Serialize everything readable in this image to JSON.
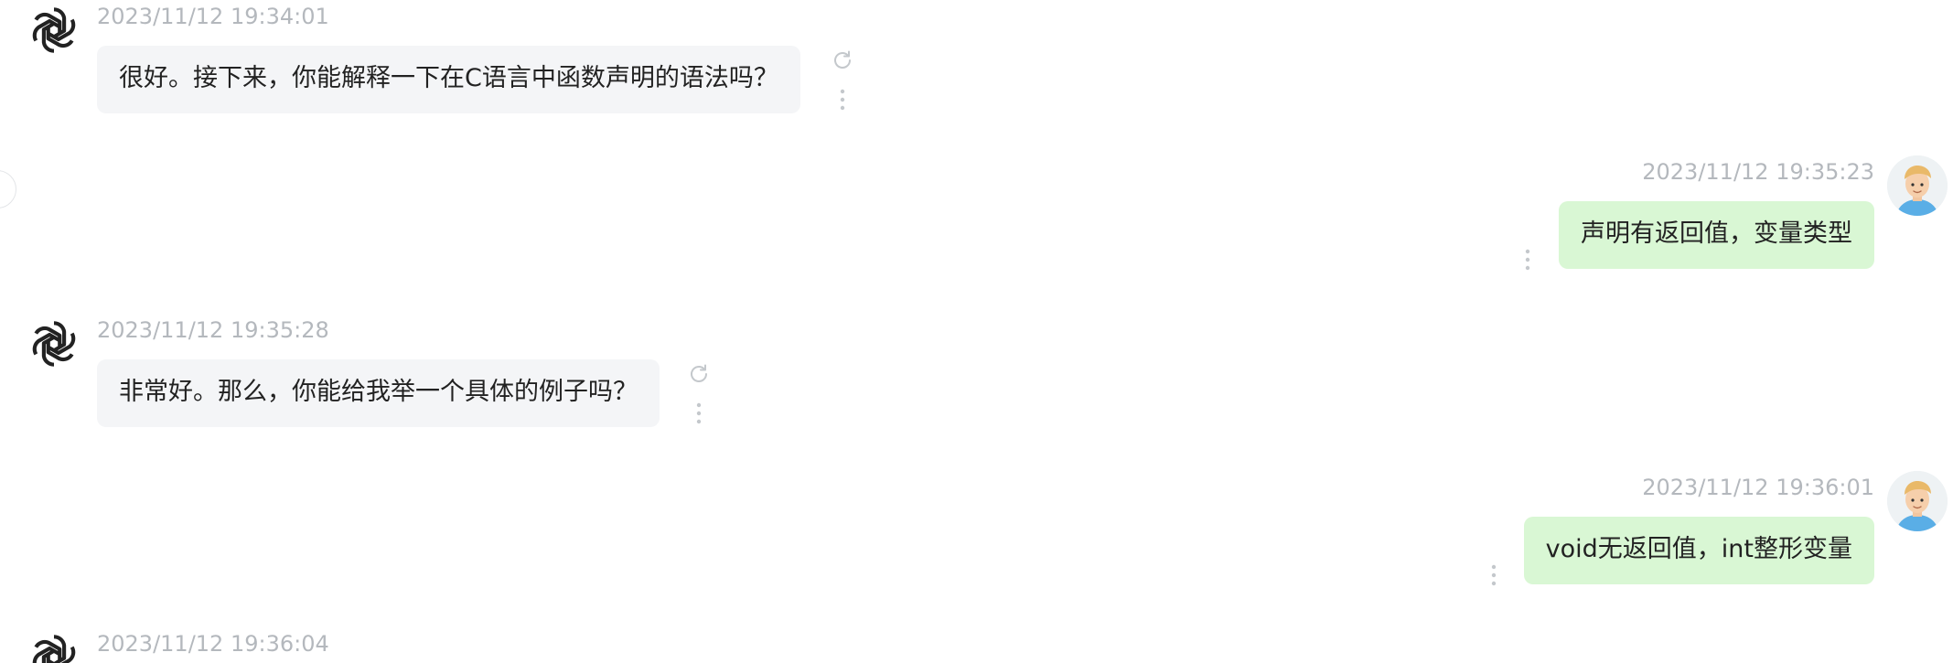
{
  "colors": {
    "ai_bubble": "#f4f5f7",
    "user_bubble": "#d9f7d4",
    "timestamp": "#b4b8bd",
    "text": "#222222"
  },
  "messages": [
    {
      "sender": "assistant",
      "timestamp": "2023/11/12 19:34:01",
      "text": "很好。接下来，你能解释一下在C语言中函数声明的语法吗？",
      "icons": [
        "openai-logo-icon",
        "refresh-icon",
        "more-vertical-icon"
      ]
    },
    {
      "sender": "user",
      "timestamp": "2023/11/12 19:35:23",
      "text": "声明有返回值，变量类型",
      "icons": [
        "user-avatar-icon",
        "more-vertical-icon"
      ]
    },
    {
      "sender": "assistant",
      "timestamp": "2023/11/12 19:35:28",
      "text": "非常好。那么，你能给我举一个具体的例子吗？",
      "icons": [
        "openai-logo-icon",
        "refresh-icon",
        "more-vertical-icon"
      ]
    },
    {
      "sender": "user",
      "timestamp": "2023/11/12 19:36:01",
      "text": "void无返回值，int整形变量",
      "icons": [
        "user-avatar-icon",
        "more-vertical-icon"
      ]
    },
    {
      "sender": "assistant",
      "timestamp": "2023/11/12 19:36:04",
      "text": "",
      "icons": [
        "openai-logo-icon"
      ]
    }
  ]
}
